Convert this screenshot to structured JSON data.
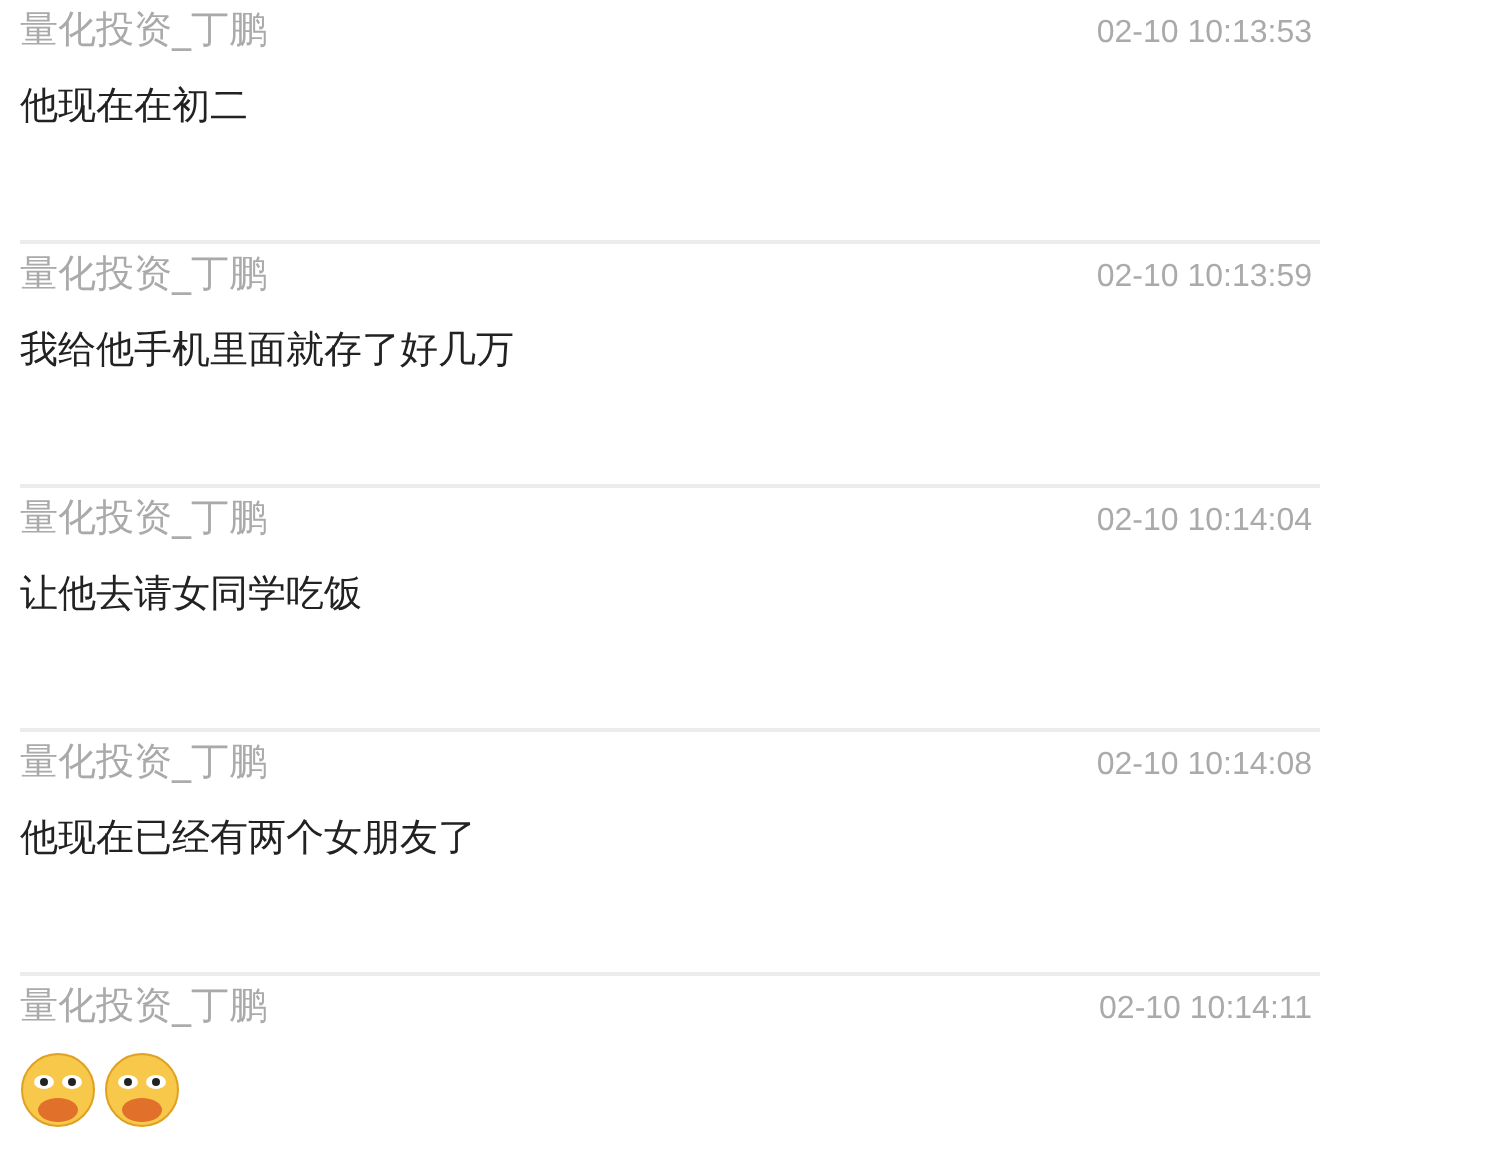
{
  "messages": [
    {
      "sender": "量化投资_丁鹏",
      "time": "02-10 10:13:53",
      "kind": "text",
      "text": "他现在在初二"
    },
    {
      "sender": "量化投资_丁鹏",
      "time": "02-10 10:13:59",
      "kind": "text",
      "text": "我给他手机里面就存了好几万"
    },
    {
      "sender": "量化投资_丁鹏",
      "time": "02-10 10:14:04",
      "kind": "text",
      "text": "让他去请女同学吃饭"
    },
    {
      "sender": "量化投资_丁鹏",
      "time": "02-10 10:14:08",
      "kind": "text",
      "text": "他现在已经有两个女朋友了"
    },
    {
      "sender": "量化投资_丁鹏",
      "time": "02-10 10:14:11",
      "kind": "emoji",
      "emojis": [
        {
          "kind": "face"
        },
        {
          "kind": "face"
        }
      ]
    }
  ]
}
